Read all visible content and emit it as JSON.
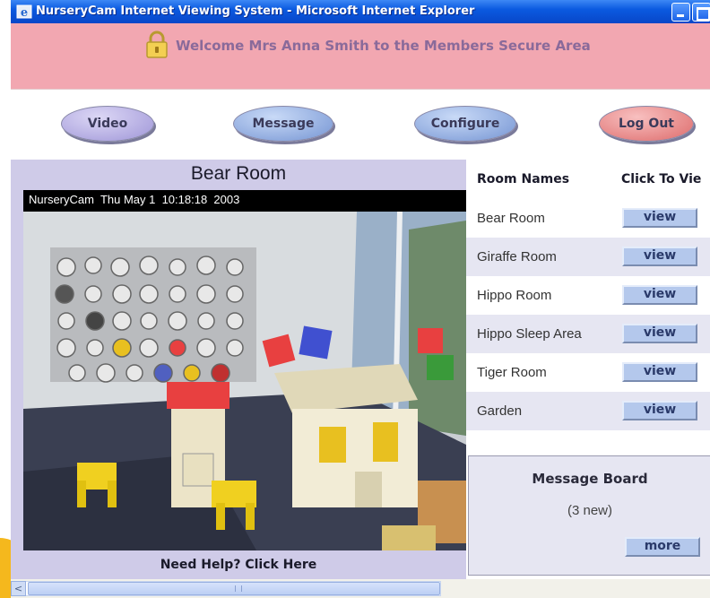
{
  "window": {
    "title": "NurseryCam Internet Viewing System - Microsoft Internet Explorer"
  },
  "welcome": {
    "message": "Welcome Mrs Anna Smith to the Members Secure Area"
  },
  "nav": {
    "video": "Video",
    "message": "Message",
    "configure": "Configure",
    "logout": "Log Out"
  },
  "camera": {
    "room_title": "Bear Room",
    "overlay": "NurseryCam  Thu May 1  10:18:18  2003"
  },
  "help": {
    "label": "Need Help? Click Here"
  },
  "rooms": {
    "header_name": "Room Names",
    "header_view": "Click To Vie",
    "button_label": "view",
    "items": [
      {
        "name": "Bear Room"
      },
      {
        "name": "Giraffe Room"
      },
      {
        "name": "Hippo Room"
      },
      {
        "name": "Hippo Sleep Area"
      },
      {
        "name": "Tiger Room"
      },
      {
        "name": "Garden"
      }
    ]
  },
  "message_board": {
    "title": "Message Board",
    "count": "(3 new)",
    "more": "more"
  },
  "scrollbar": {
    "left_arrow": "<"
  },
  "colors": {
    "welcome_bg": "#f2a7b1",
    "left_panel_bg": "#cfcbe8",
    "view_button": "#b4c8ec"
  }
}
